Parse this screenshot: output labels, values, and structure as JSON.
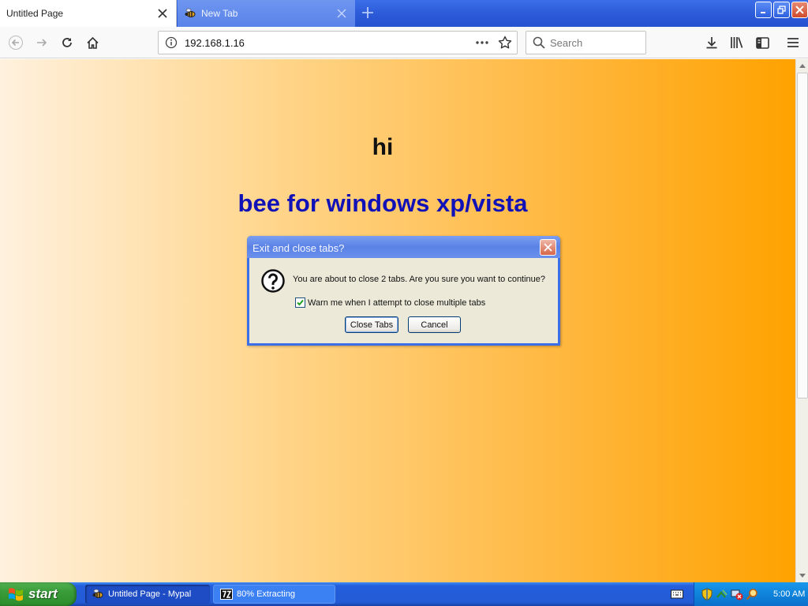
{
  "browser": {
    "tabs": [
      {
        "title": "Untitled Page",
        "active": true
      },
      {
        "title": "New Tab",
        "active": false
      }
    ],
    "url": "192.168.1.16",
    "search_placeholder": "Search",
    "icons": {
      "back": "back-arrow-icon",
      "forward": "forward-arrow-icon",
      "reload": "reload-icon",
      "home": "home-icon",
      "info": "info-icon",
      "page-actions": "more-dots-icon",
      "bookmark": "star-icon",
      "downloads": "download-icon",
      "library": "library-icon",
      "sidebar": "sidebar-icon",
      "menu": "hamburger-menu-icon"
    }
  },
  "page": {
    "heading": "hi",
    "subheading": "bee for windows xp/vista",
    "colors": {
      "heading": "#111111",
      "subheading": "#1111b8",
      "gradient_start": "#fff1de",
      "gradient_end": "#ffa200"
    }
  },
  "dialog": {
    "title": "Exit and close tabs?",
    "message": "You are about to close 2 tabs. Are you sure you want to continue?",
    "checkbox_label": "Warn me when I attempt to close multiple tabs",
    "checkbox_checked": true,
    "primary_button": "Close Tabs",
    "secondary_button": "Cancel"
  },
  "taskbar": {
    "start_label": "start",
    "items": [
      {
        "label": "Untitled Page - Mypal",
        "active": true
      },
      {
        "label": "80% Extracting",
        "active": false
      }
    ],
    "clock": "5:00 AM"
  }
}
